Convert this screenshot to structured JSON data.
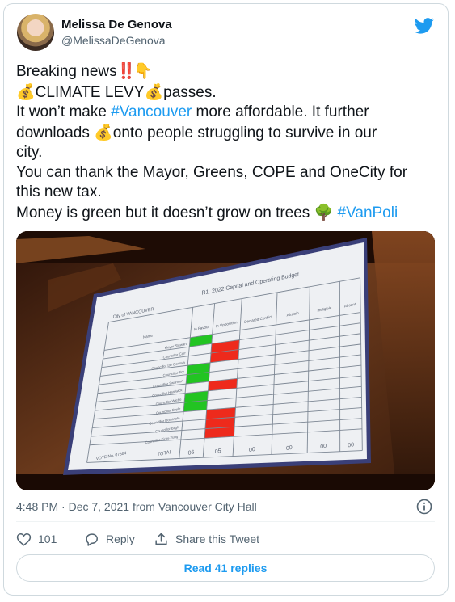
{
  "author": {
    "display_name": "Melissa De Genova",
    "handle": "@MelissaDeGenova"
  },
  "tweet": {
    "lines": [
      {
        "parts": [
          {
            "t": "text",
            "v": "Breaking news"
          },
          {
            "t": "emoji",
            "v": "‼️",
            "name": "double-exclamation"
          },
          {
            "t": "emoji",
            "v": "👇",
            "name": "pointing-down"
          }
        ]
      },
      {
        "parts": [
          {
            "t": "emoji",
            "v": "💰",
            "name": "money-bag"
          },
          {
            "t": "text",
            "v": "CLIMATE LEVY"
          },
          {
            "t": "emoji",
            "v": "💰",
            "name": "money-bag"
          },
          {
            "t": "text",
            "v": "passes."
          }
        ]
      },
      {
        "parts": [
          {
            "t": "text",
            "v": "It won’t make "
          },
          {
            "t": "link",
            "v": "#Vancouver"
          },
          {
            "t": "text",
            "v": " more affordable. It further"
          }
        ]
      },
      {
        "parts": [
          {
            "t": "text",
            "v": "downloads "
          },
          {
            "t": "emoji",
            "v": "💰",
            "name": "money-bag"
          },
          {
            "t": "text",
            "v": "onto people struggling to survive in our"
          }
        ]
      },
      {
        "parts": [
          {
            "t": "text",
            "v": "city."
          }
        ]
      },
      {
        "parts": [
          {
            "t": "text",
            "v": "You can thank the Mayor, Greens, COPE and OneCity for"
          }
        ]
      },
      {
        "parts": [
          {
            "t": "text",
            "v": "this new tax."
          }
        ]
      },
      {
        "parts": [
          {
            "t": "text",
            "v": "Money is green but it doesn’t grow on trees "
          },
          {
            "t": "emoji",
            "v": "🌳",
            "name": "tree"
          },
          {
            "t": "text",
            "v": " "
          },
          {
            "t": "link",
            "v": "#VanPoli"
          }
        ]
      }
    ]
  },
  "photo": {
    "title": "R1. 2022 Capital and Operating Budget",
    "logo_text": "City of VANCOUVER",
    "headers": [
      "Name",
      "In Favour",
      "In Opposition",
      "Declared Conflict",
      "Abstain",
      "Ineligible",
      "Absent"
    ],
    "rows": [
      {
        "name": "Mayor Stewart",
        "vote": "favour"
      },
      {
        "name": "Councillor Carr",
        "vote": "oppose"
      },
      {
        "name": "Councillor De Genova",
        "vote": "oppose"
      },
      {
        "name": "Councillor Fry",
        "vote": "favour"
      },
      {
        "name": "Councillor Swanson",
        "vote": "favour"
      },
      {
        "name": "Councillor Hardwick",
        "vote": "oppose"
      },
      {
        "name": "Councillor Wiebe",
        "vote": "favour"
      },
      {
        "name": "Councillor Boyle",
        "vote": "favour"
      },
      {
        "name": "Councillor Dominato",
        "vote": "oppose"
      },
      {
        "name": "Councillor Bligh",
        "vote": "oppose"
      },
      {
        "name": "Councillor Kirby-Yung",
        "vote": "oppose"
      }
    ],
    "vote_no": "VOTE No. 07884",
    "total_label": "TOTAL",
    "totals": [
      "06",
      "05",
      "00",
      "00",
      "00",
      "00"
    ],
    "colors": {
      "favour": "#22c422",
      "oppose": "#ee2a1c",
      "screen": "#f1f2f4",
      "lines": "#7d8794",
      "text": "#5a6270"
    }
  },
  "meta": {
    "timestamp": "4:48 PM · Dec 7, 2021 from Vancouver City Hall"
  },
  "actions": {
    "like_count": "101",
    "reply_label": "Reply",
    "share_label": "Share this Tweet"
  },
  "read_replies_label": "Read 41 replies",
  "colors": {
    "accent": "#1d9bf0",
    "muted": "#536471",
    "border": "#cfd9de"
  }
}
